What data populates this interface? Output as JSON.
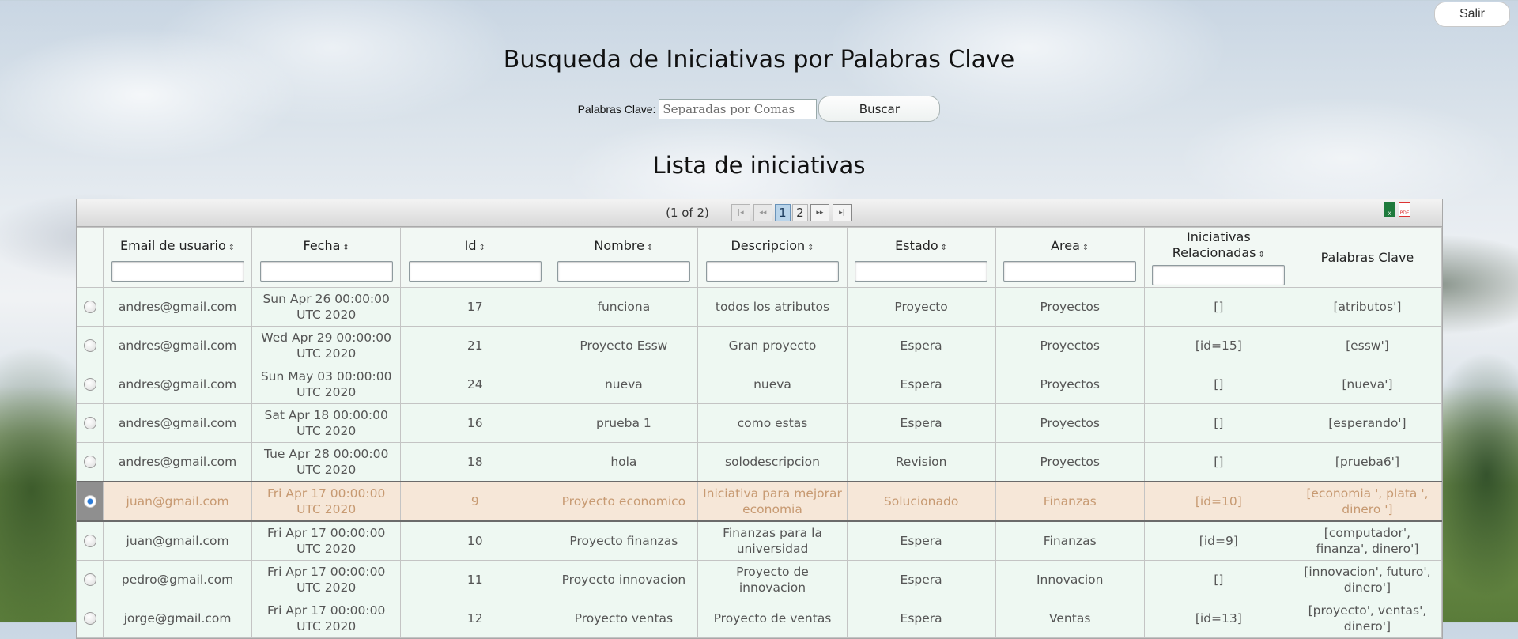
{
  "header": {
    "logout_label": "Salir"
  },
  "page_title": "Busqueda de Iniciativas por Palabras Clave",
  "search": {
    "label": "Palabras Clave:",
    "placeholder": "Separadas por Comas",
    "button_label": "Buscar"
  },
  "list_title": "Lista de iniciativas",
  "paginator": {
    "report": "(1 of 2)",
    "first": "|◂",
    "prev": "◂◂",
    "pages": [
      "1",
      "2"
    ],
    "next": "▸▸",
    "last": "▸|"
  },
  "export": {
    "xls": "xls-icon",
    "pdf": "pdf-icon",
    "xls_text": "X",
    "pdf_text": "PDF"
  },
  "columns": {
    "email": "Email de usuario",
    "fecha": "Fecha",
    "id": "Id",
    "nombre": "Nombre",
    "descripcion": "Descripcion",
    "estado": "Estado",
    "area": "Area",
    "relacionadas_1": "Iniciativas",
    "relacionadas_2": "Relacionadas",
    "palabras": "Palabras Clave",
    "sort_icon": "⇕"
  },
  "rows": [
    {
      "email": "andres@gmail.com",
      "fecha1": "Sun Apr 26 00:00:00",
      "fecha2": "UTC 2020",
      "id": "17",
      "nombre": "funciona",
      "desc": "todos los atributos",
      "estado": "Proyecto",
      "area": "Proyectos",
      "rel": "[]",
      "palabras": "[atributos']"
    },
    {
      "email": "andres@gmail.com",
      "fecha1": "Wed Apr 29 00:00:00",
      "fecha2": "UTC 2020",
      "id": "21",
      "nombre": "Proyecto Essw",
      "desc": "Gran proyecto",
      "estado": "Espera",
      "area": "Proyectos",
      "rel": "[id=15]",
      "palabras": "[essw']"
    },
    {
      "email": "andres@gmail.com",
      "fecha1": "Sun May 03 00:00:00",
      "fecha2": "UTC 2020",
      "id": "24",
      "nombre": "nueva",
      "desc": "nueva",
      "estado": "Espera",
      "area": "Proyectos",
      "rel": "[]",
      "palabras": "[nueva']"
    },
    {
      "email": "andres@gmail.com",
      "fecha1": "Sat Apr 18 00:00:00",
      "fecha2": "UTC 2020",
      "id": "16",
      "nombre": "prueba 1",
      "desc": "como estas",
      "estado": "Espera",
      "area": "Proyectos",
      "rel": "[]",
      "palabras": "[esperando']"
    },
    {
      "email": "andres@gmail.com",
      "fecha1": "Tue Apr 28 00:00:00",
      "fecha2": "UTC 2020",
      "id": "18",
      "nombre": "hola",
      "desc": "solodescripcion",
      "estado": "Revision",
      "area": "Proyectos",
      "rel": "[]",
      "palabras": "[prueba6']"
    },
    {
      "email": "juan@gmail.com",
      "fecha1": "Fri Apr 17 00:00:00",
      "fecha2": "UTC 2020",
      "id": "9",
      "nombre": "Proyecto economico",
      "desc": "Iniciativa para mejorar economia",
      "estado": "Solucionado",
      "area": "Finanzas",
      "rel": "[id=10]",
      "palabras": "[economia ', plata ', dinero ']",
      "selected": true
    },
    {
      "email": "juan@gmail.com",
      "fecha1": "Fri Apr 17 00:00:00",
      "fecha2": "UTC 2020",
      "id": "10",
      "nombre": "Proyecto finanzas",
      "desc": "Finanzas para la universidad",
      "estado": "Espera",
      "area": "Finanzas",
      "rel": "[id=9]",
      "palabras": "[computador', finanza', dinero']"
    },
    {
      "email": "pedro@gmail.com",
      "fecha1": "Fri Apr 17 00:00:00",
      "fecha2": "UTC 2020",
      "id": "11",
      "nombre": "Proyecto innovacion",
      "desc": "Proyecto de innovacion",
      "estado": "Espera",
      "area": "Innovacion",
      "rel": "[]",
      "palabras": "[innovacion', futuro', dinero']"
    },
    {
      "email": "jorge@gmail.com",
      "fecha1": "Fri Apr 17 00:00:00",
      "fecha2": "UTC 2020",
      "id": "12",
      "nombre": "Proyecto ventas",
      "desc": "Proyecto de ventas",
      "estado": "Espera",
      "area": "Ventas",
      "rel": "[id=13]",
      "palabras": "[proyecto', ventas', dinero']"
    }
  ]
}
